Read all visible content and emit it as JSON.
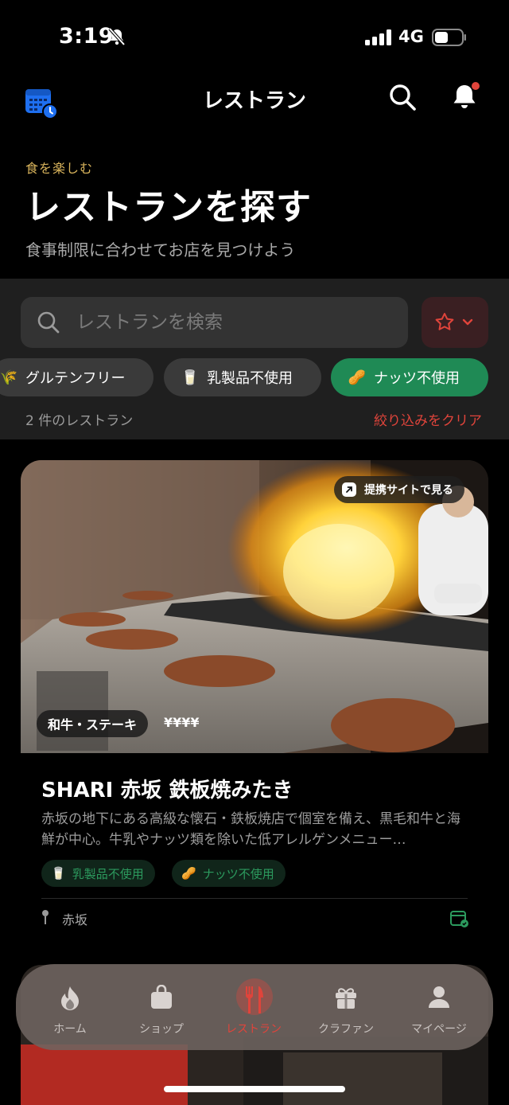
{
  "status_bar": {
    "time": "3:19",
    "network": "4G"
  },
  "nav": {
    "title": "レストラン"
  },
  "hero": {
    "eyebrow": "食を楽しむ",
    "title": "レストランを探す",
    "subtitle": "食事制限に合わせてお店を見つけよう"
  },
  "search": {
    "placeholder": "レストランを検索"
  },
  "filters": [
    {
      "label": "グルテンフリー",
      "icon": "wheat-icon",
      "active": false
    },
    {
      "label": "乳製品不使用",
      "icon": "milk-glass-icon",
      "active": false
    },
    {
      "label": "ナッツ不使用",
      "icon": "peanut-icon",
      "active": true
    }
  ],
  "results": {
    "count": "2 件のレストラン",
    "clear": "絞り込みをクリア"
  },
  "restaurant": {
    "partner_link": "提携サイトで見る",
    "category": "和牛・ステーキ",
    "price": "¥¥¥¥",
    "name": "SHARI 赤坂 鉄板焼みたき",
    "description": "赤坂の地下にある高級な懐石・鉄板焼店で個室を備え、黒毛和牛と海鮮が中心。牛乳やナッツ類を除いた低アレルゲンメニュー…",
    "tags": [
      "乳製品不使用",
      "ナッツ不使用"
    ],
    "location": "赤坂"
  },
  "tabs": [
    {
      "label": "ホーム",
      "icon": "flame-icon",
      "active": false
    },
    {
      "label": "ショップ",
      "icon": "shopping-bag-icon",
      "active": false
    },
    {
      "label": "レストラン",
      "icon": "fork-knife-icon",
      "active": true
    },
    {
      "label": "クラファン",
      "icon": "gift-icon",
      "active": false
    },
    {
      "label": "マイページ",
      "icon": "person-icon",
      "active": false
    }
  ],
  "colors": {
    "accent_red": "#e0443b",
    "accent_green": "#1f8a55",
    "eyebrow_gold": "#d9b45c",
    "calendar_blue": "#1e6ff0"
  }
}
